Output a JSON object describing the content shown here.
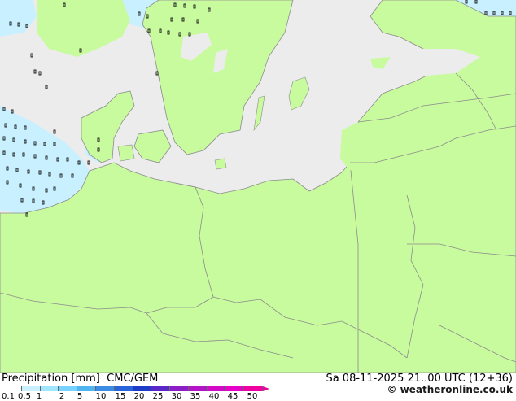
{
  "legend": {
    "title": "Precipitation [mm]",
    "model": "CMC/GEM",
    "ticks": [
      "0.1",
      "0.5",
      "1",
      "2",
      "5",
      "10",
      "15",
      "20",
      "25",
      "30",
      "35",
      "40",
      "45",
      "50"
    ],
    "colors": [
      "#ffffff",
      "#c8f0ff",
      "#a0e6ff",
      "#78d2ff",
      "#50b4f0",
      "#3c8ce6",
      "#2864dc",
      "#1e3cc8",
      "#5a28c8",
      "#8c1ec8",
      "#b414c8",
      "#d20ac8",
      "#e600c8",
      "#f000a0"
    ]
  },
  "valid_time": "Sa 08-11-2025 21..00 UTC (12+36)",
  "credit": "© weatheronline.co.uk",
  "map_colors": {
    "land": "#c8fa9e",
    "sea": "#ececec",
    "precip_light": "#c8f0ff",
    "border": "#8c8c8c"
  },
  "region": "Baltic Sea / Central Europe"
}
